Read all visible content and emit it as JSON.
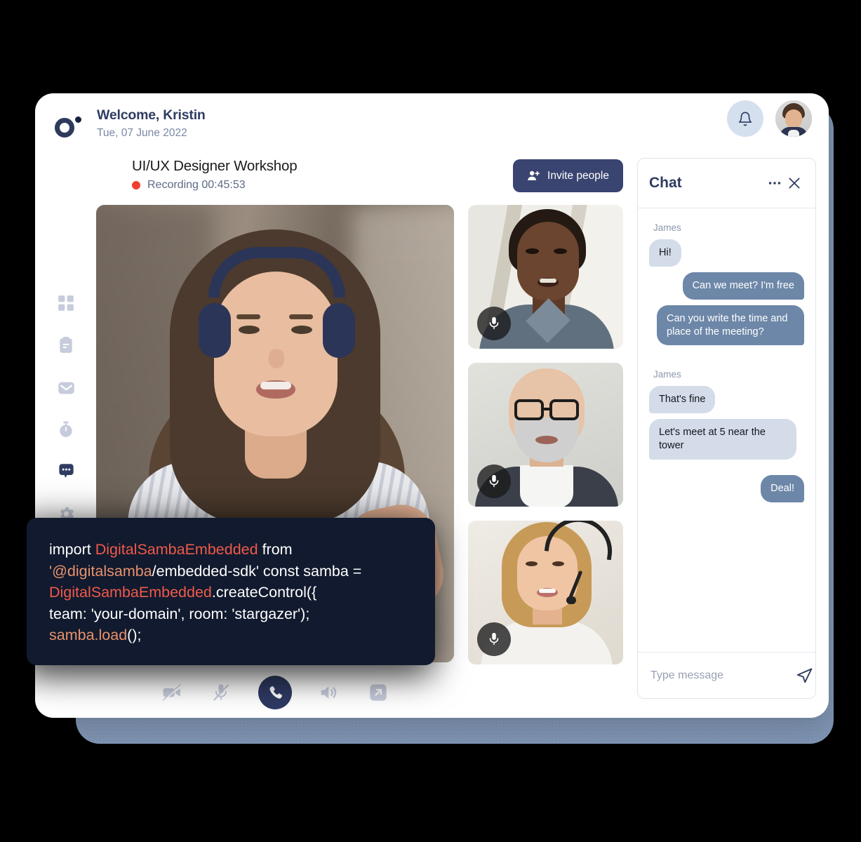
{
  "header": {
    "welcome": "Welcome, Kristin",
    "date": "Tue, 07 June 2022",
    "logo_icon": "samba-logo-icon",
    "bell_icon": "bell-icon",
    "avatar_alt": "user-avatar"
  },
  "sidebar": {
    "items": [
      {
        "name": "dashboard",
        "icon": "grid-icon",
        "active": false
      },
      {
        "name": "tasks",
        "icon": "clipboard-icon",
        "active": false
      },
      {
        "name": "mail",
        "icon": "envelope-icon",
        "active": false
      },
      {
        "name": "timer",
        "icon": "timer-icon",
        "active": false
      },
      {
        "name": "chat",
        "icon": "chat-bubble-icon",
        "active": true
      },
      {
        "name": "settings",
        "icon": "gear-icon",
        "active": false
      }
    ]
  },
  "meeting": {
    "title": "UI/UX Designer Workshop",
    "recording_label": "Recording 00:45:53",
    "recording_dot_color": "#f0402f",
    "invite_button": "Invite people",
    "invite_icon": "add-person-icon"
  },
  "controls": [
    {
      "name": "camera-off",
      "icon": "camera-off-icon",
      "style": "muted"
    },
    {
      "name": "microphone-off",
      "icon": "microphone-off-icon",
      "style": "muted"
    },
    {
      "name": "end-call",
      "icon": "phone-icon",
      "style": "primary"
    },
    {
      "name": "speaker",
      "icon": "speaker-icon",
      "style": "muted"
    },
    {
      "name": "expand",
      "icon": "arrow-expand-icon",
      "style": "muted"
    }
  ],
  "participants": [
    {
      "name": "participant-1",
      "mic_icon": "microphone-icon"
    },
    {
      "name": "participant-2",
      "mic_icon": "microphone-icon"
    },
    {
      "name": "participant-3",
      "mic_icon": "microphone-icon"
    }
  ],
  "chat": {
    "title": "Chat",
    "more_icon": "ellipsis-icon",
    "close_icon": "close-icon",
    "send_icon": "send-icon",
    "input_placeholder": "Type message",
    "input_value": "",
    "groups": [
      {
        "author": "James",
        "messages": [
          {
            "text": "Hi!",
            "side": "in"
          },
          {
            "text": "Can we meet? I'm free",
            "side": "out"
          },
          {
            "text": "Can you write the time and place of the meeting?",
            "side": "out"
          }
        ]
      },
      {
        "author": "James",
        "messages": [
          {
            "text": "That's fine",
            "side": "in"
          },
          {
            "text": "Let's meet at 5 near the tower",
            "side": "in"
          },
          {
            "text": "Deal!",
            "side": "out"
          }
        ]
      }
    ]
  },
  "code_snippet": {
    "tokens": [
      {
        "t": "import ",
        "c": "plain"
      },
      {
        "t": "DigitalSambaEmbedded",
        "c": "class"
      },
      {
        "t": " from\n",
        "c": "plain"
      },
      {
        "t": "'@digitalsamba",
        "c": "str"
      },
      {
        "t": "/embedded-sdk' const samba =\n",
        "c": "plain"
      },
      {
        "t": "DigitalSambaEmbedded",
        "c": "class"
      },
      {
        "t": ".createControl({\nteam: 'your-domain', room: 'stargazer');\n",
        "c": "plain"
      },
      {
        "t": "samba.load",
        "c": "fn"
      },
      {
        "t": "();",
        "c": "plain"
      }
    ],
    "plain_text": "import DigitalSambaEmbedded from '@digitalsamba/embedded-sdk' const samba = DigitalSambaEmbedded.createControl({ team: 'your-domain', room: 'stargazer'); samba.load();"
  },
  "colors": {
    "brand_dark": "#2f3c62",
    "accent_blue": "#3a4470",
    "backdrop": "#7e93b2",
    "bubble_in": "#d3dce8",
    "bubble_out": "#6d87a8",
    "code_bg": "#111a2e",
    "code_class": "#f05a4a",
    "code_string": "#e8926d"
  }
}
